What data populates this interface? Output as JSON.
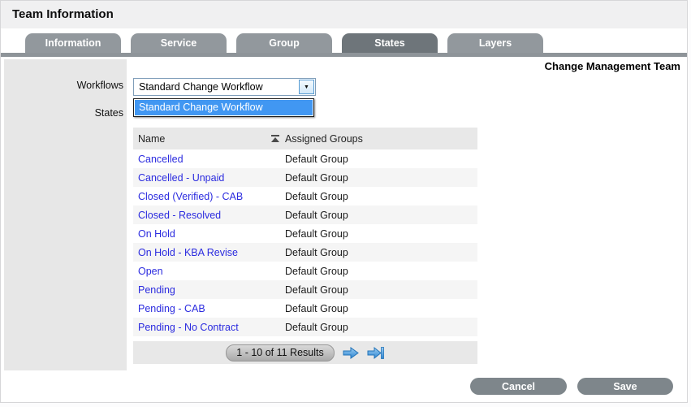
{
  "window": {
    "title": "Team Information",
    "team_name": "Change Management Team"
  },
  "tabs": [
    {
      "label": "Information",
      "active": false
    },
    {
      "label": "Service",
      "active": false
    },
    {
      "label": "Group",
      "active": false
    },
    {
      "label": "States",
      "active": true
    },
    {
      "label": "Layers",
      "active": false
    }
  ],
  "sidebar": {
    "workflows_label": "Workflows",
    "states_label": "States"
  },
  "workflow_select": {
    "value": "Standard Change Workflow",
    "options": [
      "Standard Change Workflow"
    ],
    "dropdown_open": true
  },
  "states_table": {
    "columns": {
      "name": "Name",
      "assigned_groups": "Assigned Groups"
    },
    "sort": {
      "column": "Name",
      "direction": "ascending"
    },
    "rows": [
      {
        "name": "Cancelled",
        "group": "Default Group"
      },
      {
        "name": "Cancelled - Unpaid",
        "group": "Default Group"
      },
      {
        "name": "Closed (Verified) - CAB",
        "group": "Default Group"
      },
      {
        "name": "Closed - Resolved",
        "group": "Default Group"
      },
      {
        "name": "On Hold",
        "group": "Default Group"
      },
      {
        "name": "On Hold - KBA Revise",
        "group": "Default Group"
      },
      {
        "name": "Open",
        "group": "Default Group"
      },
      {
        "name": "Pending",
        "group": "Default Group"
      },
      {
        "name": "Pending - CAB",
        "group": "Default Group"
      },
      {
        "name": "Pending - No Contract",
        "group": "Default Group"
      }
    ]
  },
  "pagination": {
    "results_label": "1 - 10 of 11 Results"
  },
  "footer": {
    "cancel_label": "Cancel",
    "save_label": "Save"
  },
  "icons": {
    "dropdown_arrow": "▼"
  },
  "colors": {
    "title_bar": "#f0f0f1",
    "tab_inactive": "#92989d",
    "tab_active": "#6e757a",
    "bar": "#8e9499",
    "panel": "#e7e7e7",
    "header_bg": "#e8e8e8",
    "alt_row": "#f5f5f5",
    "link": "#2b2bdf",
    "highlight": "#4197f2",
    "button": "#7e868b",
    "arrow_blue": "#2f86d2"
  }
}
